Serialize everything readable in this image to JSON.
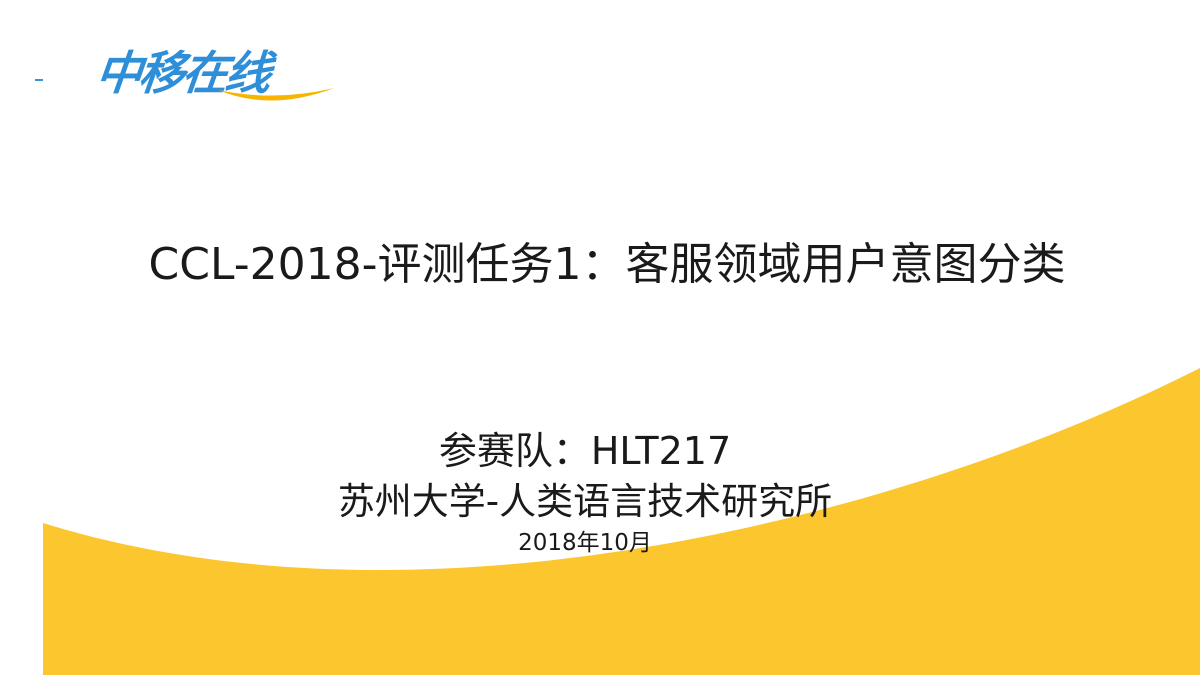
{
  "logo": {
    "text": "中移在线",
    "text_color": "#2f8ed8",
    "swoosh_color": "#f7b500"
  },
  "slide": {
    "title": "CCL-2018-评测任务1：客服领域用户意图分类",
    "team": "参赛队：HLT217",
    "affiliation": "苏州大学-人类语言技术研究所",
    "date": "2018年10月"
  },
  "colors": {
    "background": "#ffffff",
    "wave": "#fcc62e",
    "text": "#1a1a1a"
  }
}
